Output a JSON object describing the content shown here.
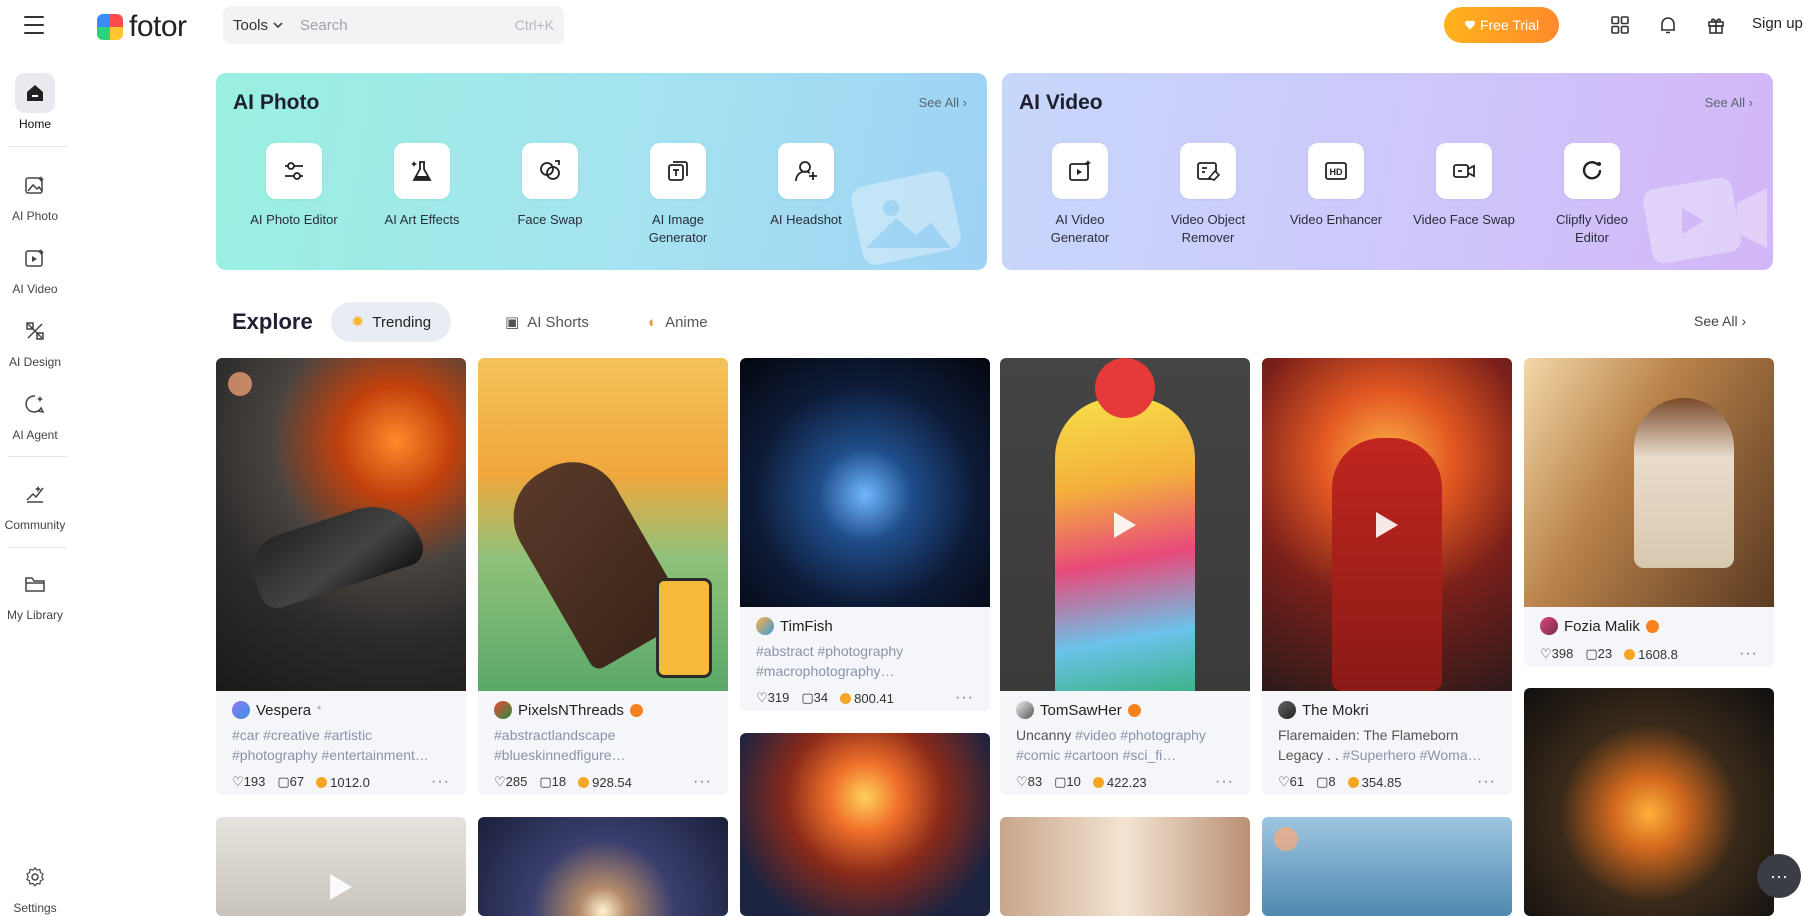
{
  "header": {
    "logo_text": "fotor",
    "tools_label": "Tools",
    "search_placeholder": "Search",
    "search_shortcut": "Ctrl+K",
    "free_trial_label": "Free Trial",
    "signup_label": "Sign up"
  },
  "sidebar": {
    "items": [
      {
        "label": "Home",
        "icon": "home-icon"
      },
      {
        "label": "AI Photo",
        "icon": "ai-photo-icon"
      },
      {
        "label": "AI Video",
        "icon": "ai-video-icon"
      },
      {
        "label": "AI Design",
        "icon": "ai-design-icon"
      },
      {
        "label": "AI Agent",
        "icon": "ai-agent-icon"
      },
      {
        "label": "Community",
        "icon": "community-icon"
      },
      {
        "label": "My Library",
        "icon": "folder-icon"
      },
      {
        "label": "Settings",
        "icon": "gear-icon"
      }
    ]
  },
  "ai_photo": {
    "title": "AI Photo",
    "see_all": "See All",
    "tools": [
      {
        "label": "AI Photo Editor"
      },
      {
        "label": "AI Art Effects"
      },
      {
        "label": "Face Swap"
      },
      {
        "label": "AI Image Generator"
      },
      {
        "label": "AI Headshot"
      }
    ]
  },
  "ai_video": {
    "title": "AI Video",
    "see_all": "See All",
    "tools": [
      {
        "label": "AI Video Generator"
      },
      {
        "label": "Video Object Remover"
      },
      {
        "label": "Video Enhancer"
      },
      {
        "label": "Video Face Swap"
      },
      {
        "label": "Clipfly Video Editor"
      }
    ]
  },
  "explore": {
    "title": "Explore",
    "see_all": "See All",
    "tabs": [
      {
        "label": "Trending"
      },
      {
        "label": "AI Shorts"
      },
      {
        "label": "Anime"
      }
    ]
  },
  "posts": [
    {
      "author": "Vespera",
      "tags": "#car #creative #artistic #photography #entertainment…",
      "likes": "193",
      "comments": "67",
      "coins": "1012.0"
    },
    {
      "author": "PixelsNThreads",
      "tags": "#abstractlandscape #blueskinnedfigure…",
      "likes": "285",
      "comments": "18",
      "coins": "928.54"
    },
    {
      "author": "TimFish",
      "tags": "#abstract #photography #macrophotography…",
      "likes": "319",
      "comments": "34",
      "coins": "800.41"
    },
    {
      "author": "TomSawHer",
      "tags_text": "Uncanny ",
      "tags": "#video #photography #comic #cartoon #sci_fi…",
      "likes": "83",
      "comments": "10",
      "coins": "422.23"
    },
    {
      "author": "The Mokri",
      "tags_text": "Flaremaiden: The Flameborn Legacy . . ",
      "tags": "#Superhero #Woma…",
      "likes": "61",
      "comments": "8",
      "coins": "354.85"
    },
    {
      "author": "Fozia Malik",
      "likes": "398",
      "comments": "23",
      "coins": "1608.8"
    }
  ],
  "colors": {
    "accent_orange": "#ff8a2b",
    "tag_color": "#8b93a8"
  }
}
